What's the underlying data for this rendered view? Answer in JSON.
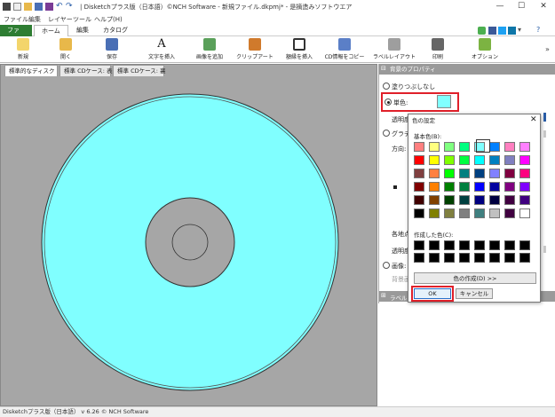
{
  "window": {
    "title": "| Disketchプラス版（日本語）©NCH Software - 新規ファイル.dkpmj* - 是摘造みソフトウエア",
    "controls": [
      "—",
      "☐",
      "✕"
    ]
  },
  "menu": [
    "ファイル",
    "編集",
    "レイヤー",
    "ツール",
    "ヘルプ(H)"
  ],
  "ribbon_tabs": [
    "ファイル",
    "ホーム",
    "編集",
    "カタログ"
  ],
  "ribbon_buttons": [
    {
      "label": "新規",
      "icon": "new-file-icon"
    },
    {
      "label": "開く",
      "icon": "open-folder-icon"
    },
    {
      "label": "保存",
      "icon": "save-icon"
    },
    {
      "label": "文字を挿入",
      "icon": "text-icon"
    },
    {
      "label": "画像を追加",
      "icon": "image-icon"
    },
    {
      "label": "クリップアート",
      "icon": "clipart-icon"
    },
    {
      "label": "額縁を挿入",
      "icon": "frame-icon"
    },
    {
      "label": "CD情報をコピー",
      "icon": "cd-info-icon"
    },
    {
      "label": "ラベルレイアウト",
      "icon": "label-layout-icon"
    },
    {
      "label": "印刷",
      "icon": "print-icon"
    },
    {
      "label": "オプション",
      "icon": "options-icon"
    }
  ],
  "doc_tabs": [
    "標準的なディスク",
    "標準 CDケース: 表",
    "標準 CDケース: 裏"
  ],
  "properties": {
    "header": "背景のプロパティ",
    "no_fill": "塗りつぶしなし",
    "solid": "単色:",
    "transparency": "透明度",
    "gradient": "グラデー",
    "direction": "方向:",
    "each_point": "各地点",
    "transparency2": "透明度",
    "image": "画像:",
    "bg_img": "背景画",
    "label_section": "ラベル"
  },
  "dialog": {
    "title": "色の設定",
    "basic_label": "基本色(B):",
    "custom_label": "作成した色(C):",
    "define_btn": "色の作成(D) >>",
    "ok": "OK",
    "cancel": "キャンセル",
    "basic_colors": [
      [
        "#ff8080",
        "#ffff80",
        "#80ff80",
        "#00ff80",
        "#80ffff",
        "#0080ff",
        "#ff80c0",
        "#ff80ff"
      ],
      [
        "#ff0000",
        "#ffff00",
        "#80ff00",
        "#00ff40",
        "#00ffff",
        "#0080c0",
        "#8080c0",
        "#ff00ff"
      ],
      [
        "#804040",
        "#ff8040",
        "#00ff00",
        "#008080",
        "#004080",
        "#8080ff",
        "#800040",
        "#ff0080"
      ],
      [
        "#800000",
        "#ff8000",
        "#008000",
        "#008040",
        "#0000ff",
        "#0000a0",
        "#800080",
        "#8000ff"
      ],
      [
        "#400000",
        "#804000",
        "#004000",
        "#004040",
        "#000080",
        "#000040",
        "#400040",
        "#400080"
      ],
      [
        "#000000",
        "#808000",
        "#808040",
        "#808080",
        "#408080",
        "#c0c0c0",
        "#400040",
        "#ffffff"
      ]
    ]
  },
  "colors": {
    "disc_fill": "#80ffff",
    "doc_bg": "#a6a6a6",
    "accent_green": "#2e7d32"
  },
  "status": "Disketchプラス版（日本語） v 6.26 © NCH Software"
}
